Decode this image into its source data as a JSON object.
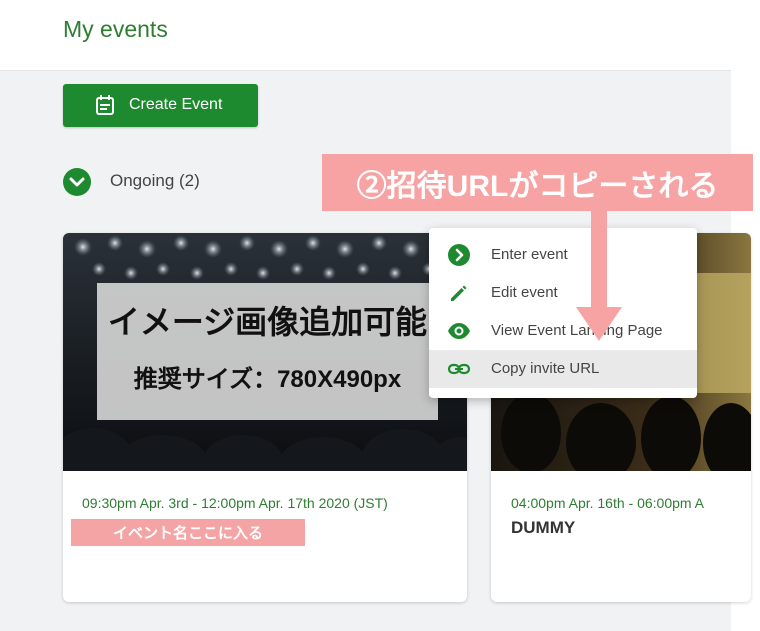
{
  "header": {
    "title": "My events"
  },
  "toolbar": {
    "create_label": "Create Event"
  },
  "section": {
    "ongoing_label": "Ongoing (2)"
  },
  "cards": [
    {
      "image_text_line1": "イメージ画像追加可能",
      "image_text_line2": "推奨サイズ：780X490px",
      "date": "09:30pm Apr. 3rd - 12:00pm Apr. 17th 2020 (JST)",
      "name": "イベント名ここに入る"
    },
    {
      "date": "04:00pm Apr. 16th - 06:00pm A",
      "name": "DUMMY"
    }
  ],
  "context_menu": {
    "items": [
      {
        "label": "Enter event",
        "icon": "arrow-circle-icon"
      },
      {
        "label": "Edit event",
        "icon": "pencil-icon"
      },
      {
        "label": "View Event Landing Page",
        "icon": "eye-icon"
      },
      {
        "label": "Copy invite URL",
        "icon": "link-icon",
        "highlighted": true
      }
    ]
  },
  "annotation": {
    "text": "②招待URLがコピーされる"
  },
  "colors": {
    "primary": "#1e8a2f",
    "title_green": "#2e7d32",
    "annotation_pink": "#f7a3a3"
  }
}
